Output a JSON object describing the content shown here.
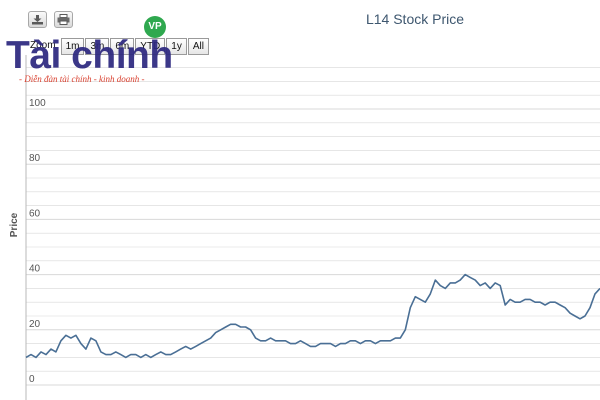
{
  "toolbar": {
    "download_icon": "download-icon",
    "print_icon": "print-icon"
  },
  "range_selector": {
    "buttons": [
      "Zoom",
      "1m",
      "3m",
      "6m",
      "YTD",
      "1y",
      "All"
    ]
  },
  "watermark": {
    "title": "Tài chính",
    "subtitle": "- Diễn đàn tài chính - kinh doanh -",
    "logo": "VP"
  },
  "colors": {
    "line": "#4a6f95",
    "grid": "#d8d8d8",
    "title": "#3e576f",
    "watermark_title": "#2d2880",
    "watermark_subtitle": "#d9402f",
    "watermark_logo": "#2fa84f"
  },
  "chart_data": {
    "type": "line",
    "title": "L14 Stock Price",
    "xlabel": "",
    "ylabel": "Price",
    "ylim": [
      0,
      100
    ],
    "yticks": [
      0,
      20,
      40,
      60,
      80,
      100
    ],
    "grid": true,
    "series": [
      {
        "values": [
          10,
          11,
          10,
          12,
          11,
          13,
          12,
          16,
          18,
          17,
          18,
          15,
          13,
          17,
          16,
          12,
          11,
          11,
          12,
          11,
          10,
          11,
          11,
          10,
          11,
          10,
          11,
          12,
          11,
          11,
          12,
          13,
          14,
          13,
          14,
          15,
          16,
          17,
          19,
          20,
          21,
          22,
          22,
          21,
          21,
          20,
          17,
          16,
          16,
          17,
          16,
          16,
          16,
          15,
          15,
          16,
          15,
          14,
          14,
          15,
          15,
          15,
          14,
          15,
          15,
          16,
          16,
          15,
          16,
          16,
          15,
          16,
          16,
          16,
          17,
          17,
          20,
          28,
          32,
          31,
          30,
          33,
          38,
          36,
          35,
          37,
          37,
          38,
          40,
          39,
          38,
          36,
          37,
          35,
          37,
          36,
          29,
          31,
          30,
          30,
          31,
          31,
          30,
          30,
          29,
          30,
          30,
          29,
          28,
          26,
          25,
          24,
          25,
          28,
          33,
          35
        ]
      }
    ]
  }
}
